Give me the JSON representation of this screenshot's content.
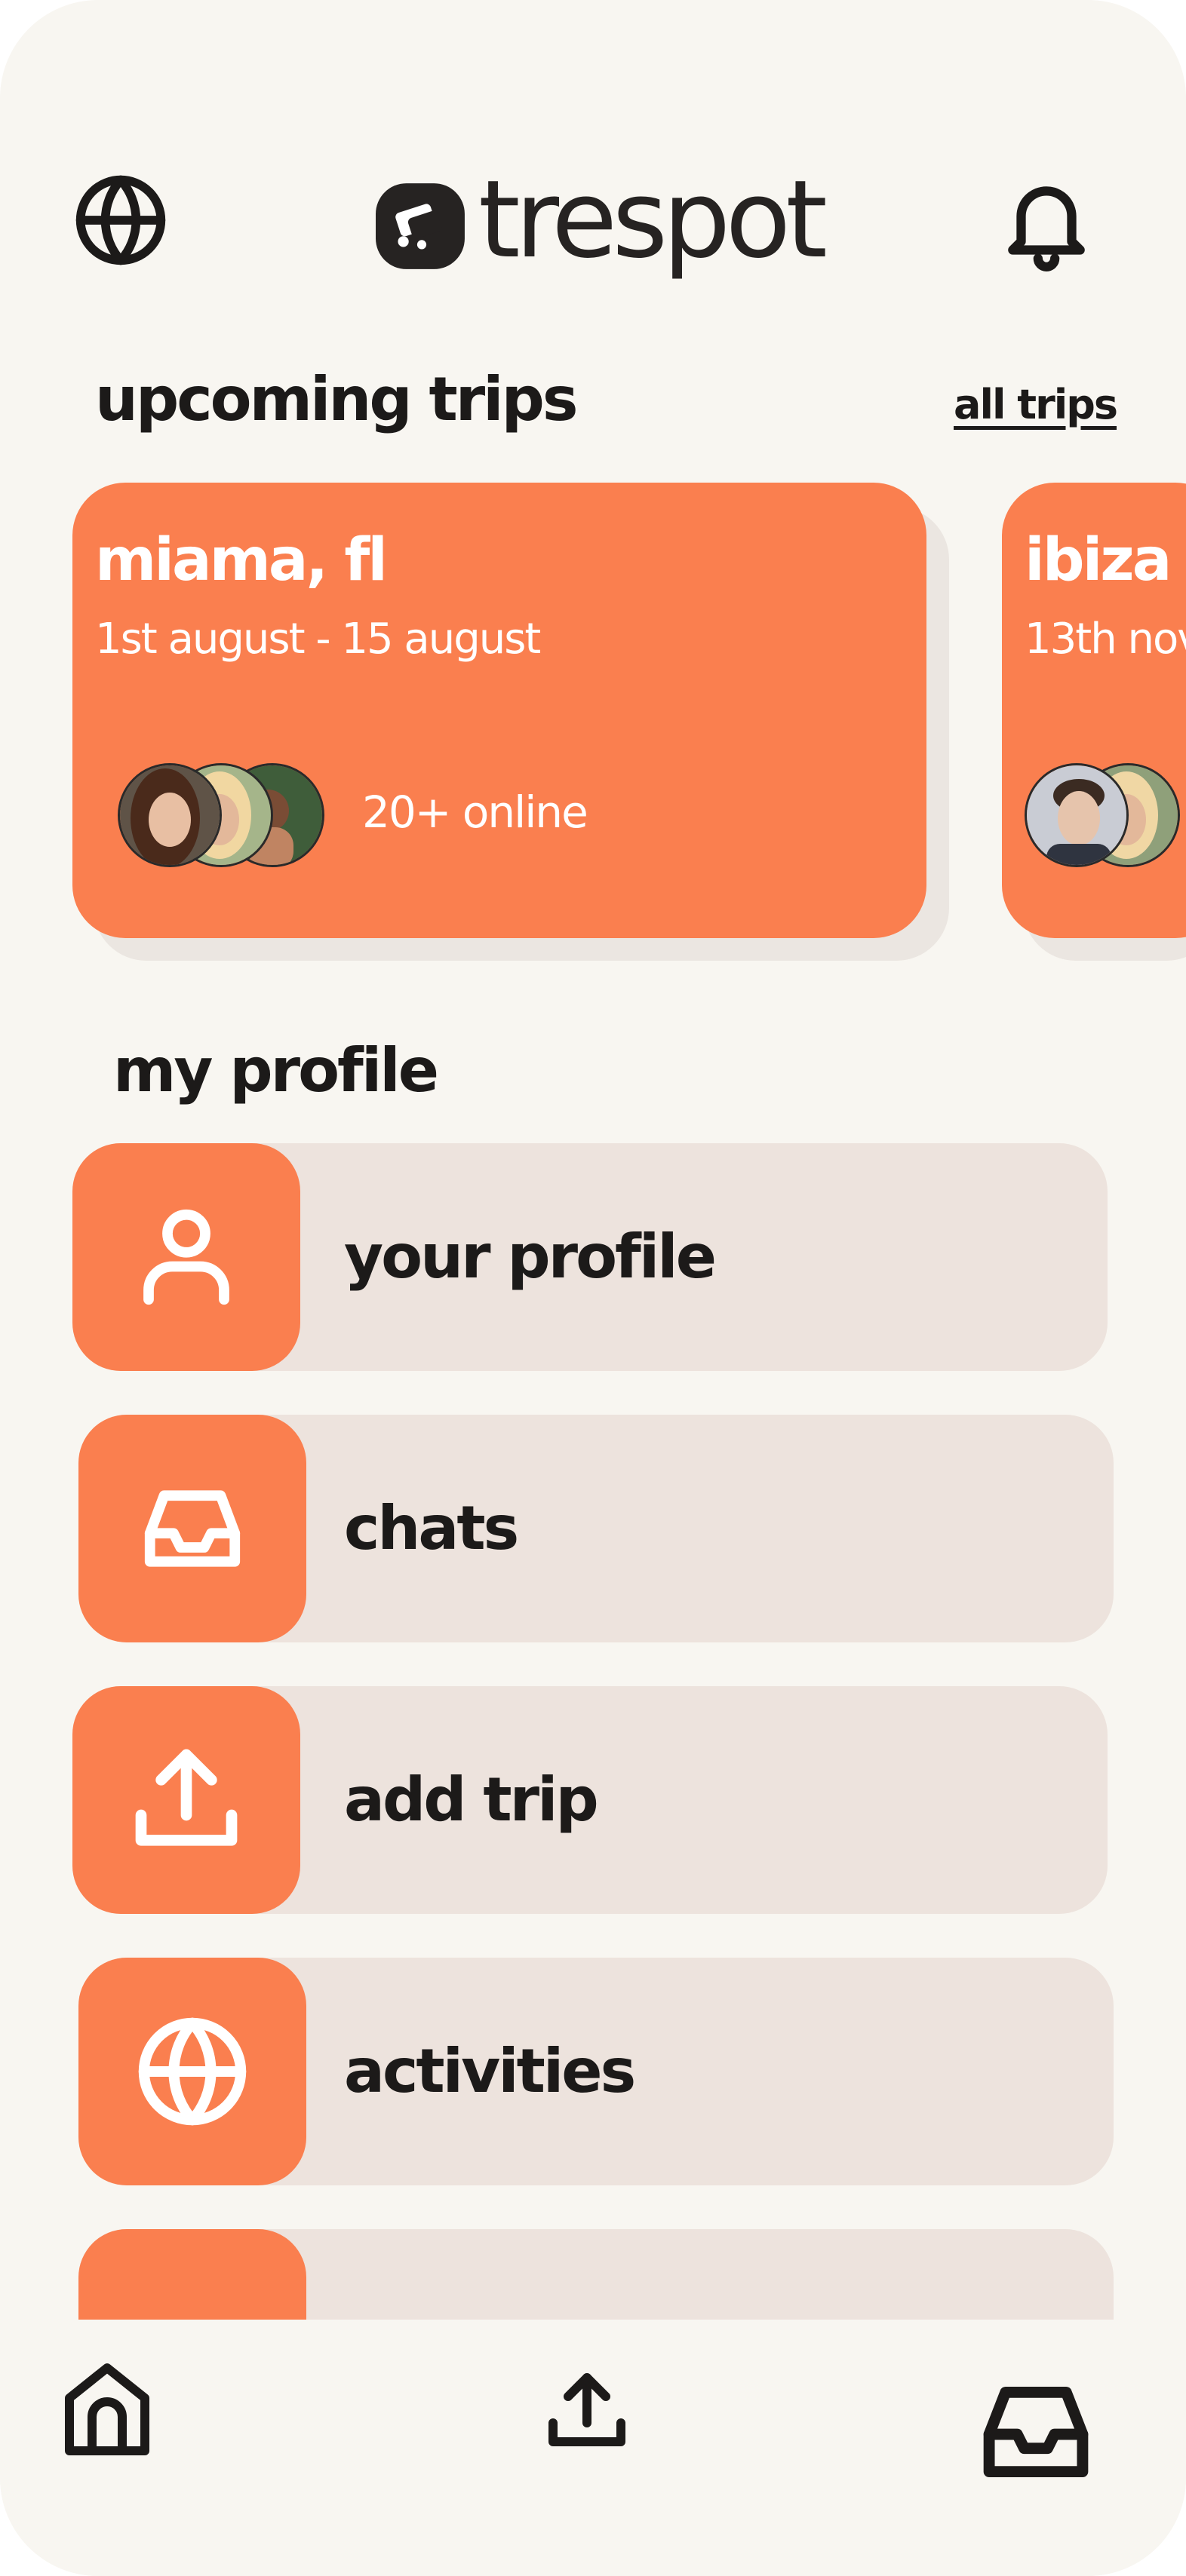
{
  "app": {
    "name": "trespot"
  },
  "header": {
    "left_icon": "globe-icon",
    "right_icon": "bell-icon"
  },
  "trips": {
    "title": "upcoming trips",
    "all_link": "all trips",
    "cards": [
      {
        "city": "miama, fl",
        "dates": "1st august - 15 august",
        "online": "20+ online"
      },
      {
        "city": "ibiza",
        "dates": "13th nov"
      }
    ]
  },
  "profile": {
    "title": "my profile",
    "items": [
      {
        "label": "your profile",
        "icon": "user-icon"
      },
      {
        "label": "chats",
        "icon": "inbox-icon"
      },
      {
        "label": "add trip",
        "icon": "upload-icon"
      },
      {
        "label": "activities",
        "icon": "globe-icon"
      }
    ]
  },
  "bottom_nav": {
    "icons": [
      "home-icon",
      "upload-icon",
      "inbox-icon"
    ]
  },
  "colors": {
    "accent": "#fa7f4f",
    "background": "#f8f6f1",
    "menu_bg": "#ede3dd",
    "text": "#1c1a19"
  }
}
